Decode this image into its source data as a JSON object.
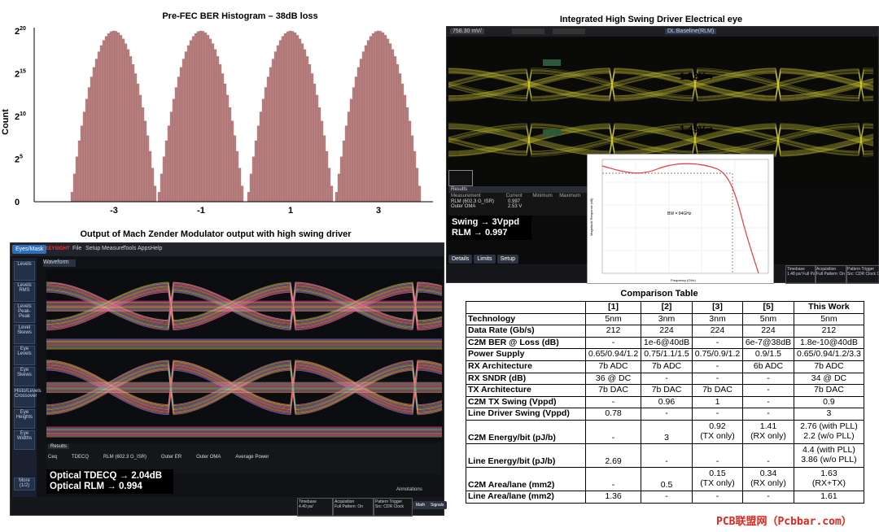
{
  "histogram": {
    "title": "Pre-FEC BER Histogram – 38dB loss",
    "ylabel": "Count",
    "yticks": [
      {
        "base": "2",
        "exp": "20"
      },
      {
        "base": "2",
        "exp": "15"
      },
      {
        "base": "2",
        "exp": "10"
      },
      {
        "base": "2",
        "exp": "5"
      },
      {
        "base": "0",
        "exp": ""
      }
    ],
    "xticks": [
      "-3",
      "-1",
      "1",
      "3"
    ],
    "colors": {
      "bar": "#b98080",
      "edge": "#8f5a5a"
    }
  },
  "chart_data": {
    "type": "bar",
    "title": "Pre-FEC BER Histogram – 38dB loss",
    "xlabel": "",
    "ylabel": "Count",
    "categories": [
      "-3",
      "-1",
      "1",
      "3"
    ],
    "scale": "log2",
    "ylim": [
      0,
      20
    ],
    "peak_log2_counts": [
      20,
      20,
      20,
      20
    ]
  },
  "eye_top": {
    "title": "Integrated High Swing Driver Electrical eye",
    "annot_upper": "1.52V",
    "annot_lower": "1.49V",
    "overlay_line1": "Swing → 3Vppd",
    "overlay_line2": "RLM → 0.997",
    "toolbar_items": [
      "758.30 mV/",
      "",
      "",
      "",
      "DL:Baseline(RLM)"
    ],
    "results_tab": "Results",
    "meas_headers": [
      "Measurement",
      "Current",
      "Minimum",
      "Maximum"
    ],
    "meas_rows": [
      [
        "RLM (602.3 G_ISR)",
        "0.997",
        "",
        ""
      ],
      [
        "Outer OMA",
        "2.53 V",
        "",
        ""
      ]
    ],
    "bottom_buttons": [
      "Details",
      "Limits",
      "Setup"
    ],
    "status_blocks": [
      {
        "label": "Timebase",
        "value": "1.48 ps/ Full Pattern: On"
      },
      {
        "label": "Acquisition",
        "value": "Full Pattern: On Averaging: Average"
      },
      {
        "label": "Pattern Trigger",
        "value": "Src: CDR Clock 1 PRBS 13Q"
      }
    ],
    "inset_text": "BW = 94GHz",
    "inset_ylabel": "Magnitude Response (dB)",
    "inset_xlabel": "Frequency (GHz)",
    "eye_color": "#d8d23a"
  },
  "eye_bottom": {
    "title": "Output of Mach Zender Modulator output with high swing driver",
    "brand": "KEYSIGHT",
    "menu": [
      "File",
      "Setup",
      "Measure",
      "Tools",
      "Apps",
      "Help"
    ],
    "sidebar_top": "Eyes/Mask",
    "sidebar_items": [
      "Levels",
      "Levels RMS",
      "Levels Peak-Peak",
      "Level Skews",
      "Eye Levels",
      "Eye Skews",
      "Histo/Levels Crossover",
      "Eye Heights",
      "Eye Widths",
      "More (1/2)"
    ],
    "waveform_tab": "Waveform",
    "results_tab": "Results",
    "meas_labels": [
      "Ceq",
      "TDECQ",
      "RLM (602.3 G_ISR)",
      "Outer ER",
      "Outer OMA",
      "Average Power"
    ],
    "overlay_line1": "Optical TDECQ → 2.04dB",
    "overlay_line2": "Optical RLM → 0.994",
    "annotations_label": "Annotations",
    "status_blocks": [
      {
        "label": "Timebase",
        "value": "4.40 ps/"
      },
      {
        "label": "Acquisition",
        "value": "Full Pattern: On"
      },
      {
        "label": "Pattern Trigger",
        "value": "Src: CDR Clock"
      }
    ],
    "buttons": [
      "Math",
      "Signals"
    ]
  },
  "comparison": {
    "title": "Comparison Table",
    "headers": [
      "",
      "[1]",
      "[2]",
      "[3]",
      "[5]",
      "This Work"
    ],
    "rows": [
      [
        "Technology",
        "5nm",
        "3nm",
        "3nm",
        "5nm",
        "5nm"
      ],
      [
        "Data Rate (Gb/s)",
        "212",
        "224",
        "224",
        "224",
        "212"
      ],
      [
        "C2M BER @ Loss (dB)",
        "-",
        "1e-6@40dB",
        "-",
        "6e-7@38dB",
        "1.8e-10@40dB"
      ],
      [
        "Power Supply",
        "0.65/0.94/1.2",
        "0.75/1.1/1.5",
        "0.75/0.9/1.2",
        "0.9/1.5",
        "0.65/0.94/1.2/3.3"
      ],
      [
        "RX Architecture",
        "7b ADC",
        "7b ADC",
        "-",
        "6b ADC",
        "7b ADC"
      ],
      [
        "RX SNDR (dB)",
        "36 @ DC",
        "-",
        "-",
        "-",
        "34 @ DC"
      ],
      [
        "TX Architecture",
        "7b DAC",
        "7b DAC",
        "7b DAC",
        "-",
        "7b DAC"
      ],
      [
        "C2M TX Swing (Vppd)",
        "-",
        "0.96",
        "1",
        "-",
        "0.9"
      ],
      [
        "Line Driver Swing (Vppd)",
        "0.78",
        "-",
        "-",
        "-",
        "3"
      ],
      [
        "C2M Energy/bit (pJ/b)",
        "-",
        "3",
        "0.92\n(TX only)",
        "1.41\n(RX only)",
        "2.76 (with PLL)\n2.2 (w/o PLL)"
      ],
      [
        "Line Energy/bit (pJ/b)",
        "2.69",
        "-",
        "-",
        "-",
        "4.4 (with PLL)\n3.86 (w/o PLL)"
      ],
      [
        "C2M Area/lane (mm2)",
        "-",
        "0.5",
        "0.15\n(TX only)",
        "0.34\n(RX only)",
        "1.63\n(RX+TX)"
      ],
      [
        "Line Area/lane (mm2)",
        "1.36",
        "-",
        "-",
        "-",
        "1.61"
      ]
    ]
  },
  "watermark": "PCB联盟网（Pcbbar.com）"
}
